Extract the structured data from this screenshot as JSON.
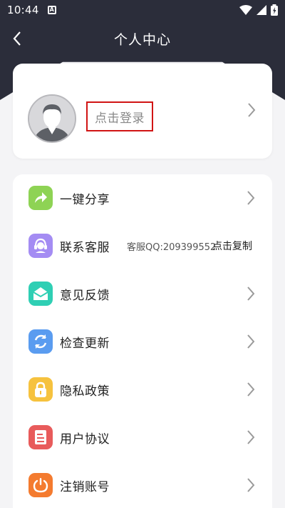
{
  "status_bar": {
    "time": "10:44",
    "notification_icon": "A"
  },
  "nav": {
    "title": "个人中心",
    "back_icon": "chevron-left-icon"
  },
  "profile": {
    "login_label": "点击登录",
    "avatar_icon": "default-avatar-icon",
    "highlight_color": "#d11414"
  },
  "menu": {
    "items": [
      {
        "label": "一键分享",
        "icon": "share-icon",
        "color": "#8ed354"
      },
      {
        "label": "联系客服",
        "icon": "customer-service-icon",
        "color": "#a48cf3",
        "info": "客服QQ:209399552",
        "action": "点击复制"
      },
      {
        "label": "意见反馈",
        "icon": "feedback-mail-icon",
        "color": "#2fcfb4"
      },
      {
        "label": "检查更新",
        "icon": "refresh-icon",
        "color": "#5a9cf0"
      },
      {
        "label": "隐私政策",
        "icon": "lock-icon",
        "color": "#f6c23e"
      },
      {
        "label": "用户协议",
        "icon": "document-icon",
        "color": "#e85b5b"
      },
      {
        "label": "注销账号",
        "icon": "power-icon",
        "color": "#f47b2f"
      }
    ]
  },
  "colors": {
    "header": "#2b2d3a",
    "background": "#f4f4f6"
  }
}
